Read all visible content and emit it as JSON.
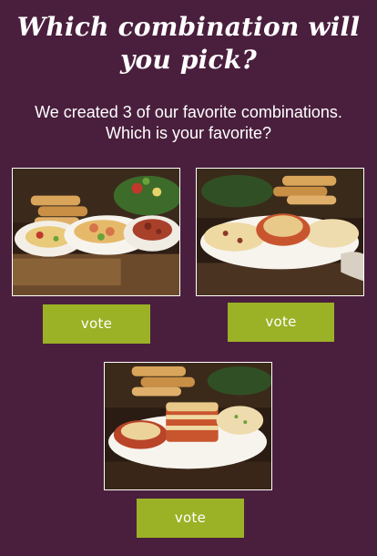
{
  "header": {
    "title_line1": "Which combination will",
    "title_line2": "you pick?",
    "subtitle_line1": "We created 3 of our favorite combinations.",
    "subtitle_line2": "Which is your favorite?"
  },
  "options": [
    {
      "vote_label": "vote"
    },
    {
      "vote_label": "vote"
    },
    {
      "vote_label": "vote"
    }
  ],
  "colors": {
    "background": "#4a1f3d",
    "accent": "#9bb126",
    "text": "#ffffff"
  }
}
